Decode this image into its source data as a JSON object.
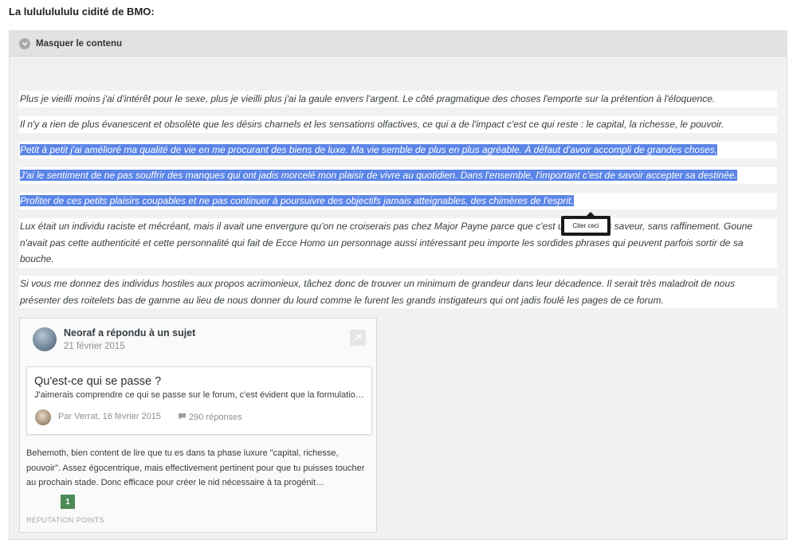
{
  "heading": "La lulululululu cidité de BMO:",
  "spoiler": {
    "toggle_label": "Masquer le contenu"
  },
  "paragraphs": {
    "p1": "Plus je vieilli moins j'ai d'intérêt pour le sexe, plus je vieilli plus j'ai la gaule envers l'argent. Le côté pragmatique des choses l'emporte sur la prétention à l'éloquence.",
    "p2": "Il n'y a rien de plus évanescent et obsolète que les désirs charnels et les sensations olfactives, ce qui a de l'impact c'est ce qui reste : le capital, la richesse, le pouvoir.",
    "p3": "Petit à petit j'ai amélioré ma qualité de vie en me procurant des biens de luxe. Ma vie semble de plus en plus agréable. À défaut d'avoir accompli de grandes choses,",
    "p4": "J'ai le sentiment de ne pas souffrir des manques qui ont jadis morcelé mon plaisir de vivre au quotidien. Dans l'ensemble, l'important c'est de savoir accepter sa destinée.",
    "p5": "Profiter de ces petits plaisirs coupables et ne pas continuer à poursuivre des objectifs jamais atteignables, des chimères de l'esprit.",
    "p6": "Lux était un individu raciste et mécréant, mais il avait une envergure qu'on ne croiserais pas chez Major Payne parce que c'est un idiot sans saveur, sans raffinement. Goune n'avait pas cette authenticité et cette personnalité qui fait de Ecce Homo un personnage aussi intéressant peu importe les sordides phrases qui peuvent parfois sortir de sa bouche.",
    "p7": "Si vous me donnez des individus hostiles aux propos acrimonieux, tâchez donc de trouver un minimum de grandeur dans leur décadence. Il serait très maladroit de nous présenter des roitelets bas de gamme au lieu de nous donner du lourd comme le furent les grands instigateurs qui ont jadis foulé les pages de ce forum."
  },
  "quote_tooltip": "Citer ceci",
  "embed": {
    "author_line": "Neoraf a répondu à un sujet",
    "date": "21 février 2015",
    "card": {
      "title": "Qu'est-ce qui se passe ?",
      "excerpt": "J'aimerais comprendre ce qui se passe sur le forum, c'est évident que la formulation de ce forum était la plus aboutie qui soit",
      "meta": "Par Verrat, 16 février 2015",
      "replies": "290 réponses"
    },
    "body": "Behemoth, bien content de lire que tu es dans ta phase luxure \"capital, richesse, pouvoir\". Assez égocentrique, mais effectivement pertinent pour que tu puisses toucher au prochain stade. Donc efficace pour créer le nid nécessaire à ta progénit…",
    "reputation_count": "1",
    "reputation_label": "REPUTATION POINTS"
  },
  "colors": {
    "selection": "#5b85e6",
    "reputation_badge": "#4d8a55",
    "spoiler_header": "#e2e2e2"
  },
  "icons": [
    "chevron-down-circle-icon",
    "external-link-icon",
    "comment-bubble-icon"
  ]
}
